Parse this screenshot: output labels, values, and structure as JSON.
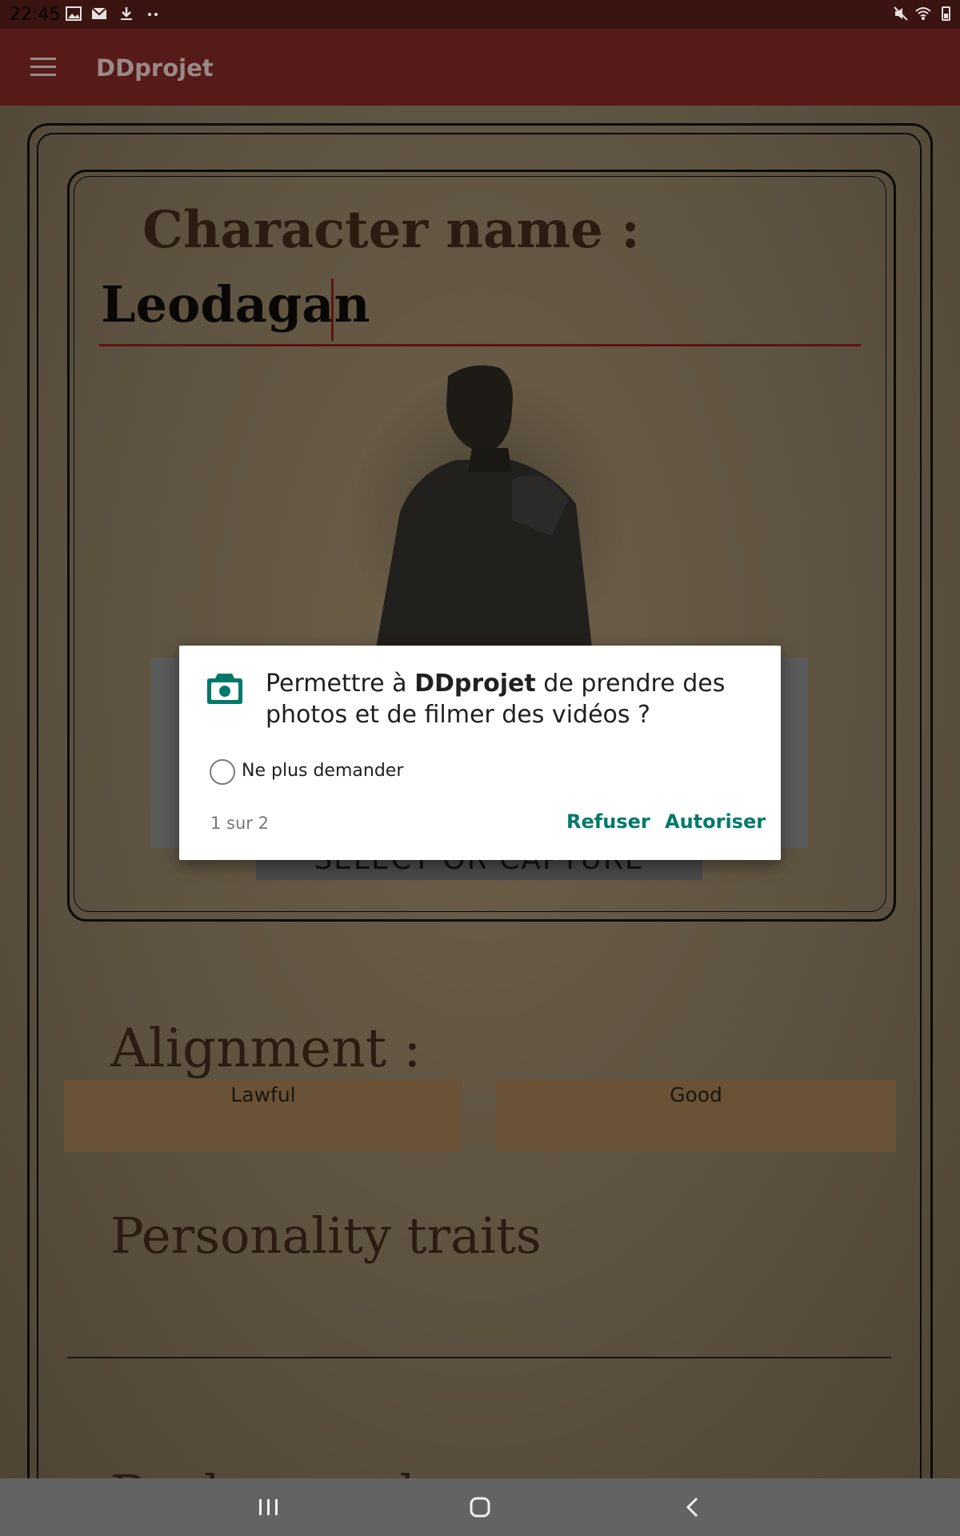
{
  "status_bar": {
    "time": "22:45"
  },
  "app_bar": {
    "title": "DDprojet",
    "menu_icon": "hamburger-menu-icon"
  },
  "character": {
    "name_label": "Character name :",
    "name_value": "Leodagan",
    "avatar_button_label": "SELECT OR CAPTURE AVATAR"
  },
  "alignment": {
    "label": "Alignment :",
    "law_value": "Lawful",
    "good_value": "Good"
  },
  "personality": {
    "label": "Personality traits"
  },
  "background": {
    "label": "Background"
  },
  "dialog": {
    "icon": "camera-icon",
    "message_prefix": "Permettre à ",
    "app_name": "DDprojet",
    "message_suffix": " de prendre des photos et de filmer des vidéos ?",
    "dont_ask_label": "Ne plus demander",
    "page_indicator": "1 sur 2",
    "deny_label": "Refuser",
    "allow_label": "Autoriser",
    "accent_color": "#00796b"
  },
  "nav_bar": {
    "recents_icon": "recents-icon",
    "home_icon": "home-icon",
    "back_icon": "back-icon"
  }
}
